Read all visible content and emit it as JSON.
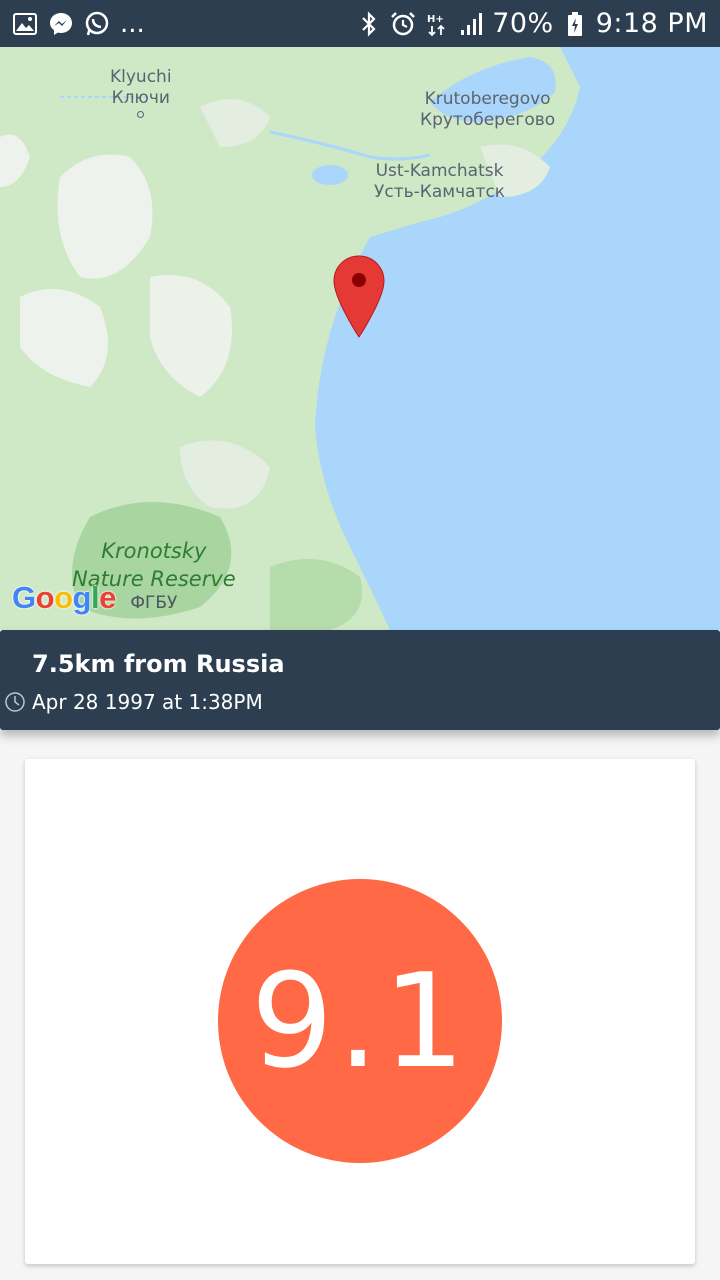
{
  "status_bar": {
    "dots": "...",
    "battery": "70%",
    "time": "9:18 PM",
    "icons": [
      "gallery-icon",
      "messenger-icon",
      "whatsapp-icon",
      "bluetooth-icon",
      "alarm-icon",
      "network-icon",
      "signal-icon",
      "battery-icon"
    ]
  },
  "map": {
    "labels": {
      "klyuchi_en": "Klyuchi",
      "klyuchi_ru": "Ключи",
      "krutoberegovo_en": "Krutoberegovo",
      "krutoberegovo_ru": "Крутоберегово",
      "ust_kamchatsk_en": "Ust-Kamchatsk",
      "ust_kamchatsk_ru": "Усть-Камчатск",
      "kronotsky_1": "Kronotsky",
      "kronotsky_2": "Nature Reserve",
      "kronotsky_3": "ФГБУ"
    },
    "logo": {
      "g1": "G",
      "o1": "o",
      "o2": "o",
      "g2": "g",
      "l": "l",
      "e": "e"
    },
    "colors": {
      "water": "#aad6fb",
      "land": "#cfe8c6",
      "marker": "#e53935"
    }
  },
  "quake": {
    "title": "7.5km from Russia",
    "time": "Apr 28 1997 at 1:38PM",
    "magnitude": "9.1",
    "magnitude_color": "#ff6945"
  }
}
